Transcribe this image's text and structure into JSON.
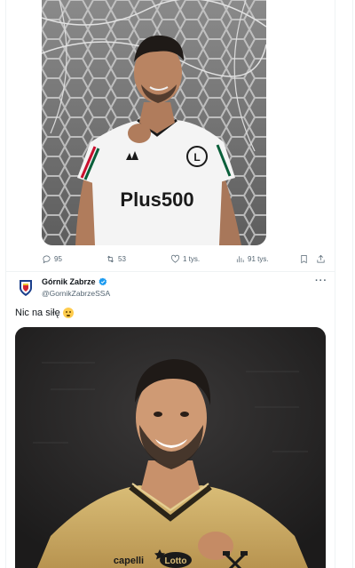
{
  "tweet1": {
    "image_alt": "Piłkarz w białej koszulce Legii Warszawa",
    "shirt_sponsor": "Plus500",
    "club_crest_letter": "L",
    "actions": {
      "replies": "95",
      "retweets": "53",
      "likes": "1 tys.",
      "views": "91 tys."
    }
  },
  "tweet2": {
    "display_name": "Górnik Zabrze",
    "handle": "@GornikZabrzeSSA",
    "text": "Nic na siłę",
    "image_alt": "Piłkarz w złotej koszulce Górnika Zabrze",
    "shirt_sponsors": [
      "capelli",
      "Lotto"
    ]
  },
  "icons": [
    "reply-icon",
    "retweet-icon",
    "like-icon",
    "views-icon",
    "bookmark-icon",
    "share-icon",
    "verified-icon",
    "more-icon",
    "emoji-icon"
  ],
  "colors": {
    "accent": "#1d9bf0",
    "secondary_text": "#536471",
    "divider": "#eff3f4",
    "gornik_gold": "#c8a860",
    "gornik_blue": "#1b3f8b",
    "gornik_red": "#d22630"
  }
}
